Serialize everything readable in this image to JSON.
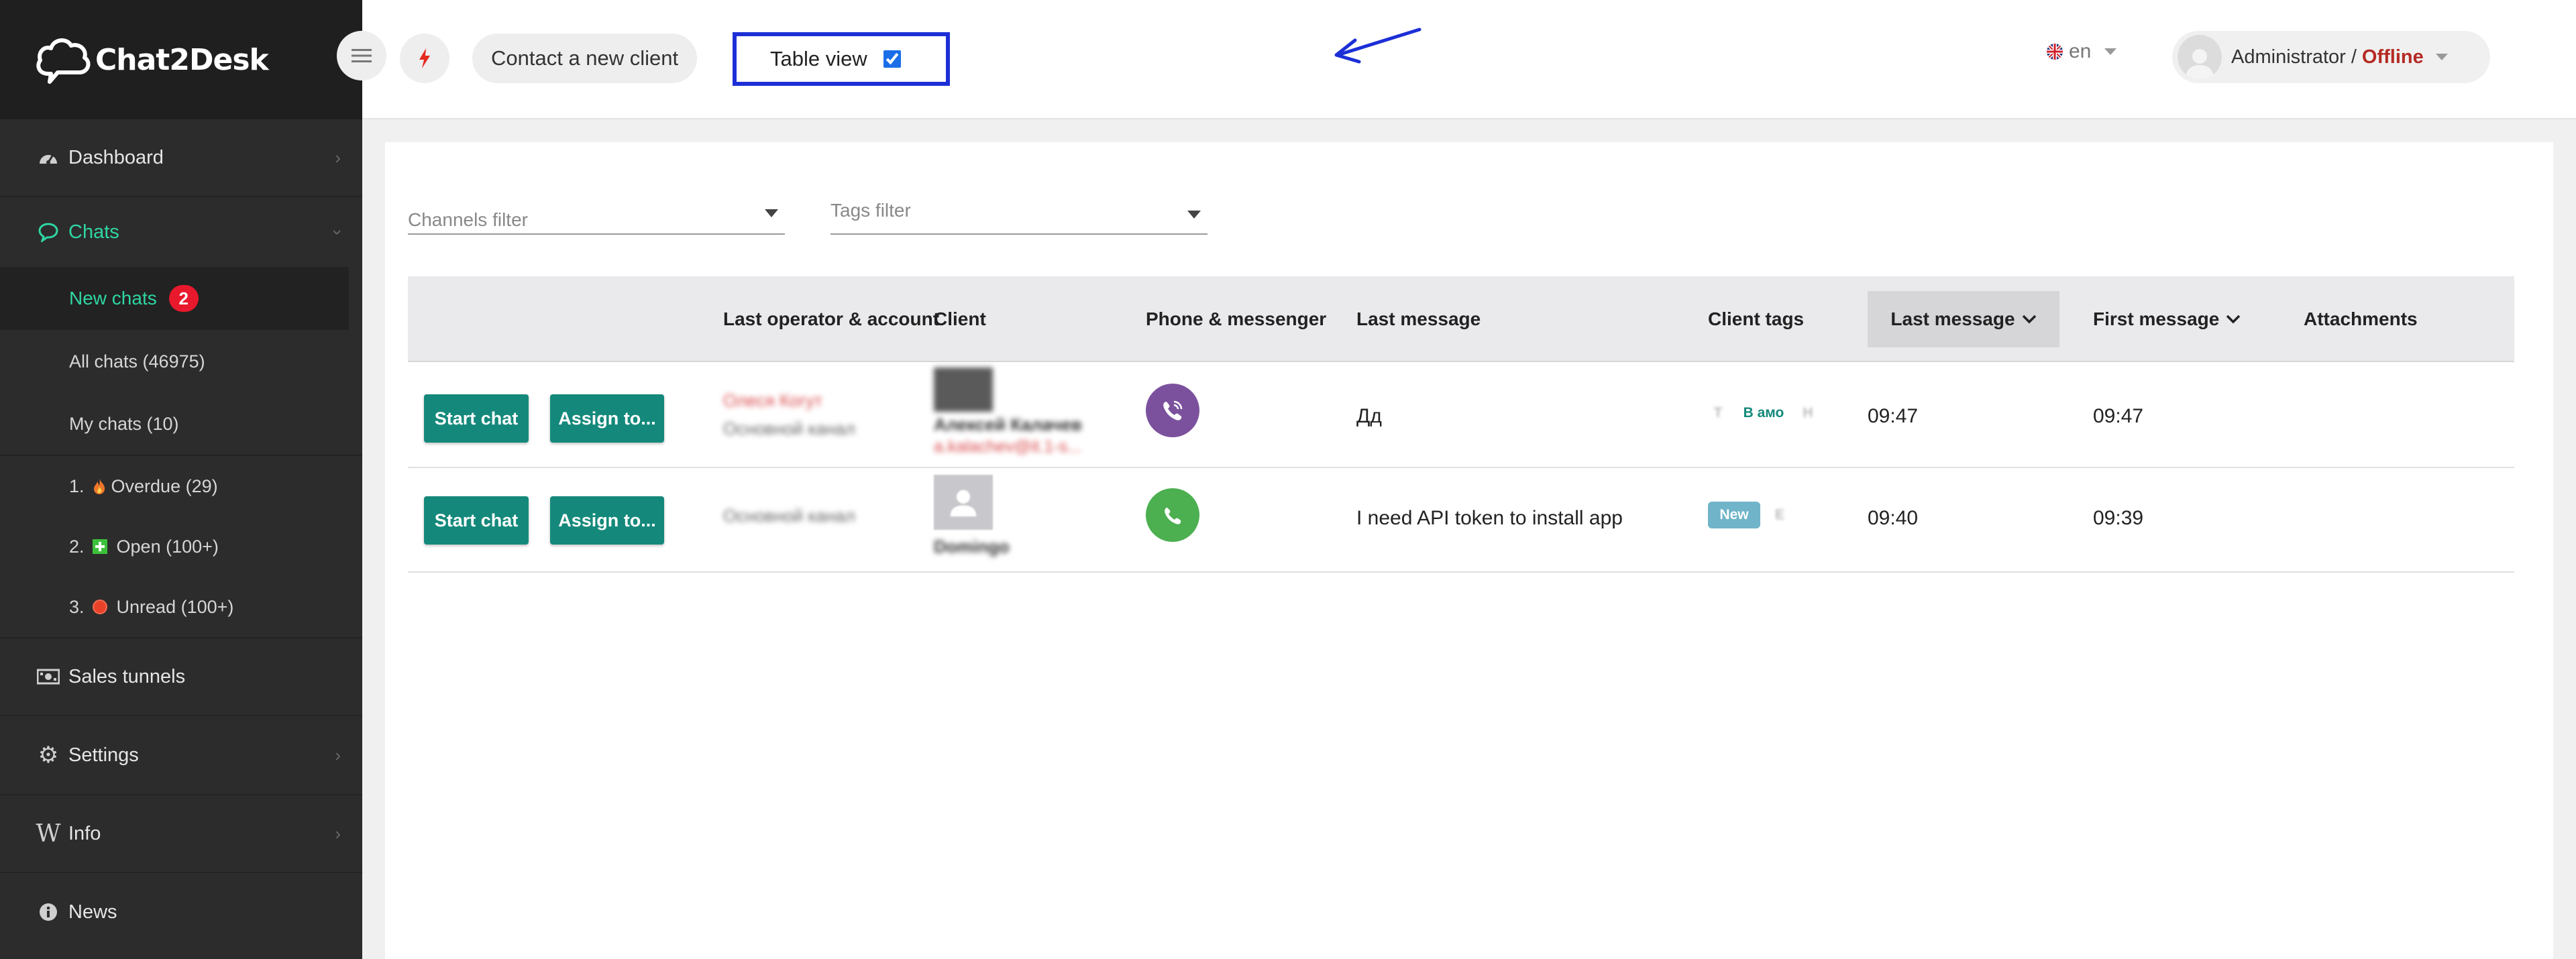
{
  "app": {
    "brand": "Chat2Desk"
  },
  "sidebar": {
    "dashboard": "Dashboard",
    "chats": "Chats",
    "new_chats": "New chats",
    "new_chats_count": "2",
    "all_chats": "All chats (46975)",
    "my_chats": "My chats (10)",
    "overdue_num": "1.",
    "overdue": "Overdue",
    "overdue_count": "(29)",
    "open_num": "2.",
    "open": "Open",
    "open_count": "(100+)",
    "unread_num": "3.",
    "unread": "Unread",
    "unread_count": "(100+)",
    "sales_tunnels": "Sales tunnels",
    "settings": "Settings",
    "info": "Info",
    "news": "News"
  },
  "header": {
    "contact_new_client": "Contact a new client",
    "table_view": "Table view",
    "table_view_checked": true,
    "language": "en",
    "user_role": "Administrator",
    "separator": "/",
    "user_status": "Offline"
  },
  "filters": {
    "channels": "Channels filter",
    "tags": "Tags filter"
  },
  "table": {
    "columns": {
      "operator": "Last operator & account",
      "client": "Client",
      "phone": "Phone & messenger",
      "last_message_text": "Last message",
      "client_tags": "Client tags",
      "last_message_time": "Last message",
      "first_message_time": "First message",
      "attachments": "Attachments"
    },
    "rows": [
      {
        "start_chat": "Start chat",
        "assign": "Assign to...",
        "operator": "Олеся Когут",
        "account": "Основной канал",
        "client_name": "Алексей Калачев",
        "client_email": "a.kalachev@it.1-s...",
        "messenger": "viber",
        "last_message": "Дд",
        "tags": [
          "Т",
          "В амо",
          "Н"
        ],
        "last_time": "09:47",
        "first_time": "09:47"
      },
      {
        "start_chat": "Start chat",
        "assign": "Assign to...",
        "operator": "",
        "account": "Основной канал",
        "client_name": "Domingo",
        "client_email": "",
        "messenger": "whatsapp",
        "last_message": "I need API token to install app",
        "tags": [
          "New",
          "Е"
        ],
        "last_time": "09:40",
        "first_time": "09:39"
      }
    ]
  },
  "colors": {
    "accent_teal": "#14897b",
    "sidebar_bg": "#2c2c2c",
    "active_green": "#2fd6a3",
    "badge_red": "#e8192c",
    "highlight_blue": "#1c2fd6",
    "offline_red": "#b52a24",
    "viber": "#7b519d",
    "whatsapp": "#4caf50"
  }
}
